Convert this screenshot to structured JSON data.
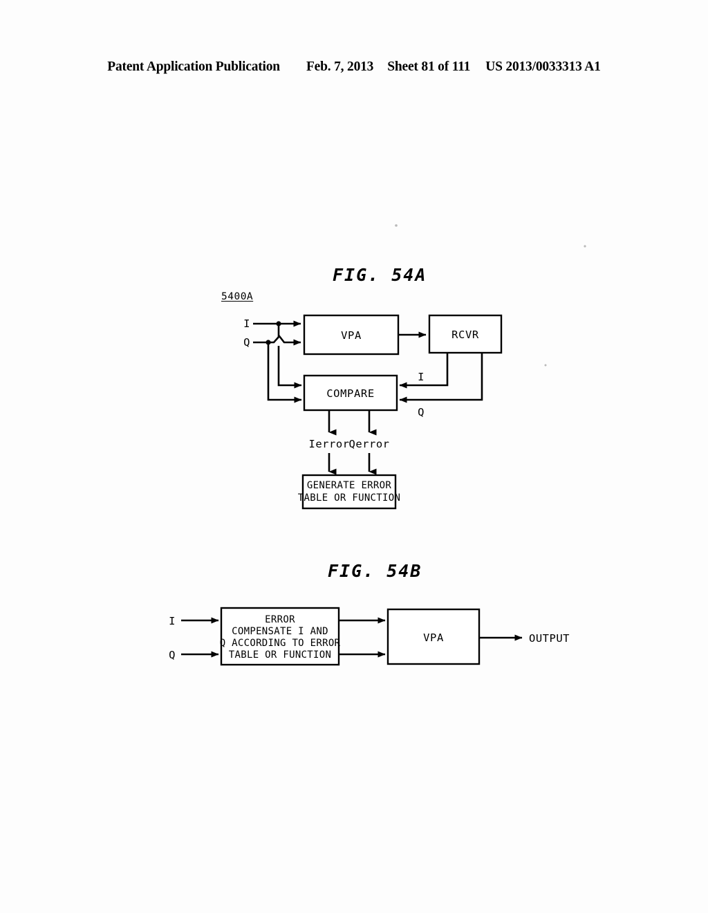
{
  "header": {
    "publication": "Patent Application Publication",
    "date": "Feb. 7, 2013",
    "sheet": "Sheet 81 of 111",
    "pub_number": "US 2013/0033313 A1"
  },
  "figures": [
    {
      "id": "fig-54a",
      "title": "FIG. 54A",
      "reference_numeral": "5400A",
      "blocks": [
        {
          "name": "vpa",
          "label": "VPA"
        },
        {
          "name": "rcvr",
          "label": "RCVR"
        },
        {
          "name": "compare",
          "label": "COMPARE"
        },
        {
          "name": "generate-error-table",
          "lines": [
            "GENERATE ERROR",
            "TABLE OR FUNCTION"
          ]
        }
      ],
      "signals": {
        "input_i": "I",
        "input_q": "Q",
        "feedback_i": "I",
        "feedback_q": "Q",
        "error_i": "Ierror",
        "error_q": "Qerror"
      }
    },
    {
      "id": "fig-54b",
      "title": "FIG. 54B",
      "blocks": [
        {
          "name": "error-compensate",
          "lines": [
            "ERROR",
            "COMPENSATE I AND",
            "Q ACCORDING TO ERROR",
            "TABLE OR FUNCTION"
          ]
        },
        {
          "name": "vpa",
          "label": "VPA"
        }
      ],
      "signals": {
        "input_i": "I",
        "input_q": "Q",
        "output": "OUTPUT"
      }
    }
  ],
  "colors": {
    "ink": "#000000",
    "paper": "#ffffff"
  }
}
